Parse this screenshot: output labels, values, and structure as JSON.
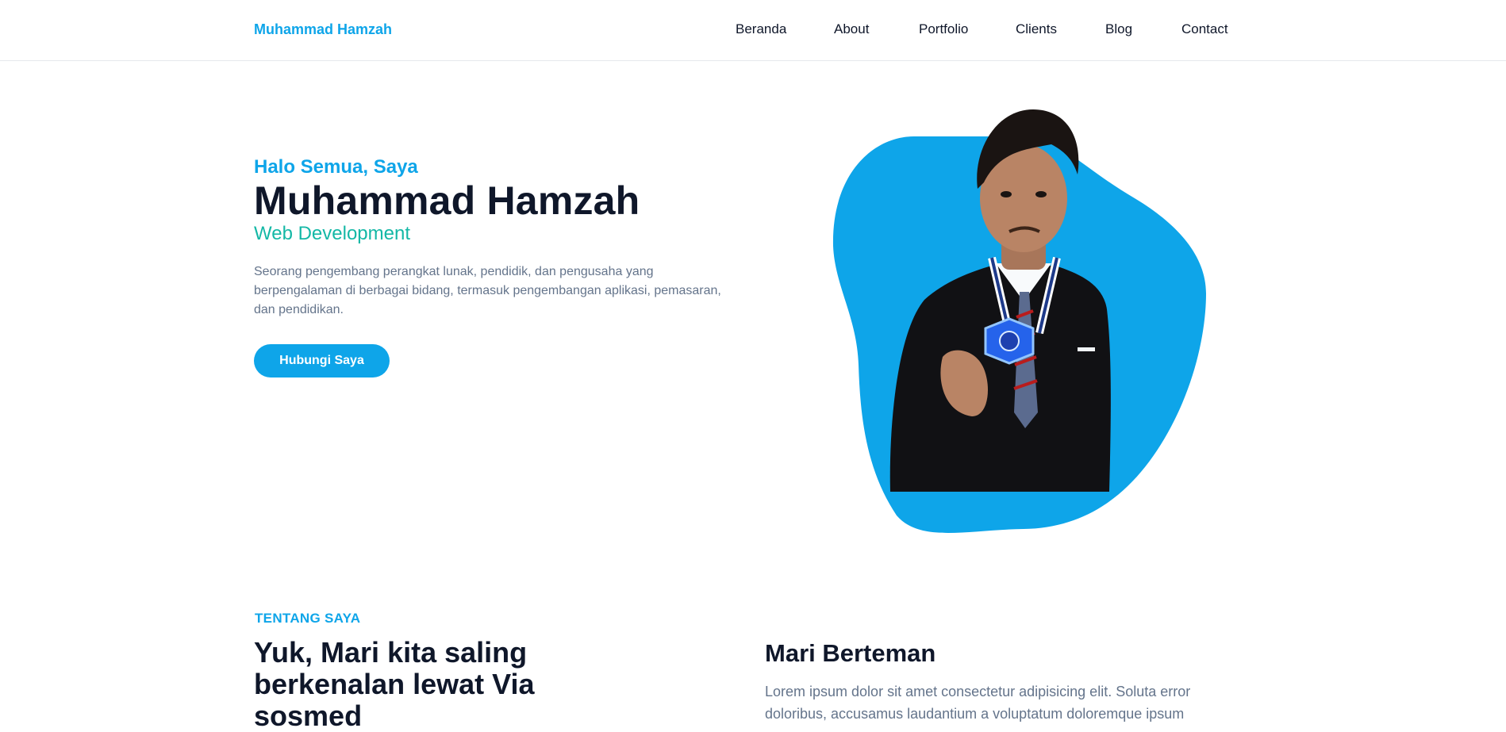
{
  "colors": {
    "primary": "#0ea5e9",
    "accent": "#14b8a6",
    "dark": "#0f172a",
    "muted": "#64748b"
  },
  "header": {
    "brand": "Muhammad Hamzah",
    "nav": [
      "Beranda",
      "About",
      "Portfolio",
      "Clients",
      "Blog",
      "Contact"
    ]
  },
  "hero": {
    "greeting": "Halo Semua, Saya",
    "name": "Muhammad Hamzah",
    "role": "Web Development",
    "description": "Seorang pengembang perangkat lunak, pendidik, dan pengusaha yang berpengalaman di berbagai bidang, termasuk pengembangan aplikasi, pemasaran, dan pendidikan.",
    "cta_label": "Hubungi Saya"
  },
  "about": {
    "eyebrow": "TENTANG SAYA",
    "title": "Yuk, Mari kita saling berkenalan lewat Via sosmed",
    "friends_title": "Mari Berteman",
    "friends_text": "Lorem ipsum dolor sit amet consectetur adipisicing elit. Soluta error doloribus, accusamus laudantium a voluptatum doloremque ipsum"
  }
}
